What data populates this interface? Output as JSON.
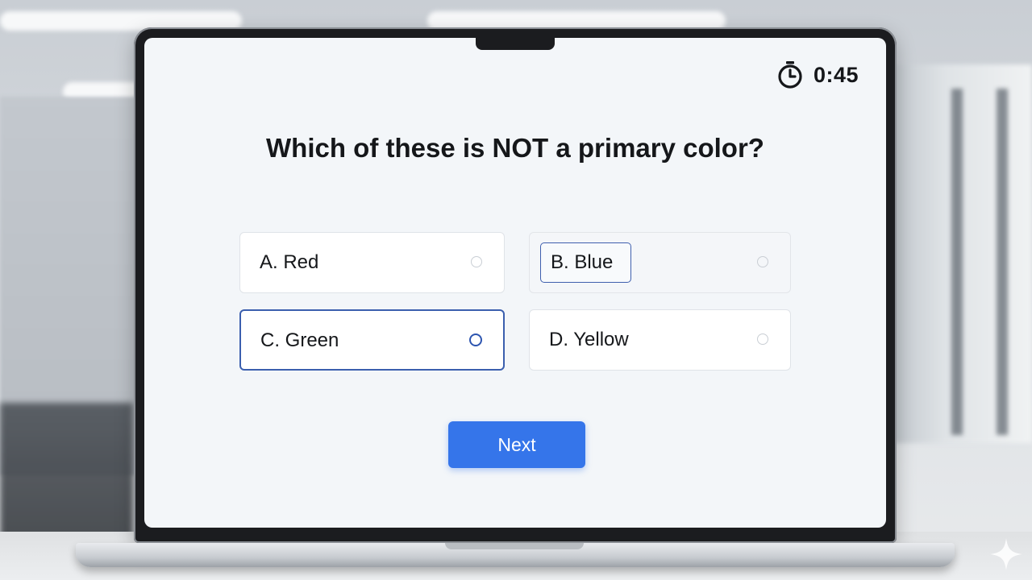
{
  "timer": {
    "value": "0:45",
    "icon": "stopwatch-icon"
  },
  "quiz": {
    "question": "Which of these is NOT a primary color?",
    "options": [
      {
        "label": "A. Red",
        "state": "default"
      },
      {
        "label": "B. Blue",
        "state": "hovered"
      },
      {
        "label": "C. Green",
        "state": "selected"
      },
      {
        "label": "D. Yellow",
        "state": "default"
      }
    ],
    "next_label": "Next"
  },
  "colors": {
    "accent": "#3575ea",
    "selected_border": "#3b5fae",
    "screen_background": "#f3f6f9",
    "text": "#15171a"
  }
}
